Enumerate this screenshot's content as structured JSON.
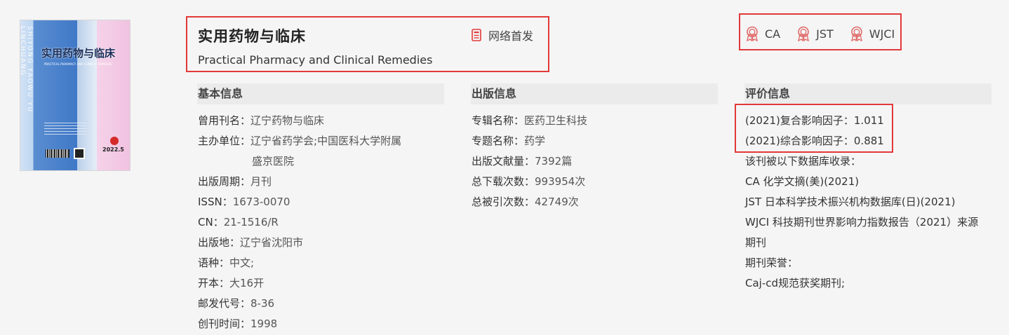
{
  "cover": {
    "spine": "SHIYONG YAOWU YU LINCHUANG",
    "title": "实用药物与临床",
    "subtitle": "PRACTICAL PHARMACY AND CLINICAL REMEDIES",
    "issue": "2022.5"
  },
  "header": {
    "title_cn": "实用药物与临床",
    "title_en": "Practical Pharmacy and Clinical Remedies",
    "online_first": "网络首发",
    "databases": [
      "CA",
      "JST",
      "WJCI"
    ]
  },
  "basic": {
    "heading": "基本信息",
    "rows": [
      {
        "k": "曾用刊名：",
        "v": "辽宁药物与临床"
      },
      {
        "k": "主办单位：",
        "v": "辽宁省药学会;中国医科大学附属",
        "v2": "盛京医院"
      },
      {
        "k": "出版周期：",
        "v": "月刊"
      },
      {
        "k": "ISSN：",
        "v": "1673-0070"
      },
      {
        "k": "CN：",
        "v": "21-1516/R"
      },
      {
        "k": "出版地：",
        "v": "辽宁省沈阳市"
      },
      {
        "k": "语种：",
        "v": "中文;"
      },
      {
        "k": "开本：",
        "v": "大16开"
      },
      {
        "k": "邮发代号：",
        "v": "8-36"
      },
      {
        "k": "创刊时间：",
        "v": "1998"
      }
    ]
  },
  "publish": {
    "heading": "出版信息",
    "rows": [
      {
        "k": "专辑名称：",
        "v": "医药卫生科技"
      },
      {
        "k": "专题名称：",
        "v": "药学"
      },
      {
        "k": "出版文献量：",
        "v": "7392篇"
      },
      {
        "k": "总下载次数：",
        "v": "993954次"
      },
      {
        "k": "总被引次数：",
        "v": "42749次"
      }
    ]
  },
  "evaluation": {
    "heading": "评价信息",
    "impact_composite": "(2021)复合影响因子：1.011",
    "impact_comprehensive": "(2021)综合影响因子：0.881",
    "included_label": "该刊被以下数据库收录：",
    "included": [
      "CA 化学文摘(美)(2021)",
      "JST 日本科学技术振兴机构数据库(日)(2021)",
      "WJCI 科技期刊世界影响力指数报告（2021）来源",
      "期刊"
    ],
    "honor_label": "期刊荣誉：",
    "honor": "Caj-cd规范获奖期刊;"
  }
}
